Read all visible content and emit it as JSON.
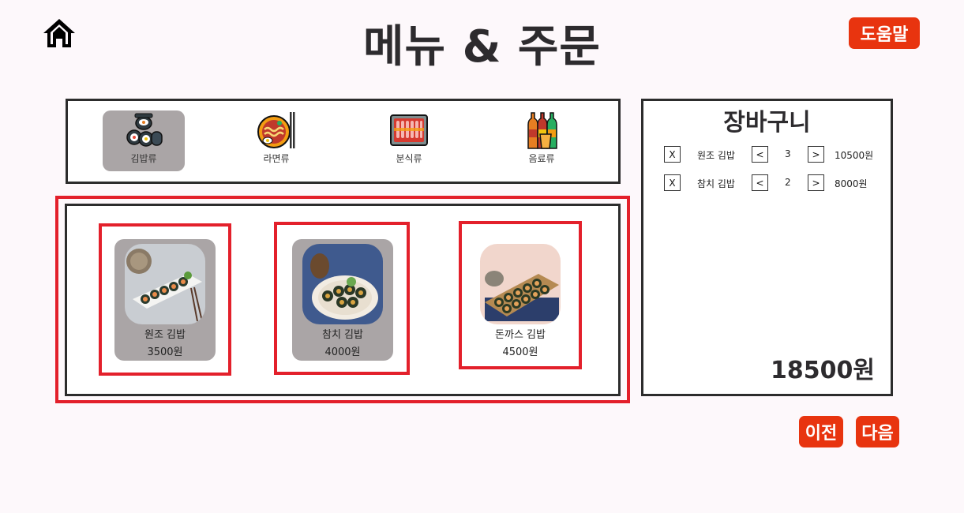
{
  "header": {
    "title": "메뉴 & 주문",
    "help_label": "도움말"
  },
  "categories": [
    {
      "label": "김밥류",
      "icon": "gimbap-icon",
      "active": true
    },
    {
      "label": "라면류",
      "icon": "ramen-icon",
      "active": false
    },
    {
      "label": "분식류",
      "icon": "tteokbokki-icon",
      "active": false
    },
    {
      "label": "음료류",
      "icon": "drinks-icon",
      "active": false
    }
  ],
  "menu_items": [
    {
      "name": "원조 김밥",
      "price": "3500원"
    },
    {
      "name": "참치 김밥",
      "price": "4000원"
    },
    {
      "name": "돈까스 김밥",
      "price": "4500원"
    }
  ],
  "cart": {
    "title": "장바구니",
    "remove_label": "X",
    "dec_label": "<",
    "inc_label": ">",
    "items": [
      {
        "name": "원조 김밥",
        "qty": "3",
        "subtotal": "10500원"
      },
      {
        "name": "참치 김밥",
        "qty": "2",
        "subtotal": "8000원"
      }
    ],
    "total": "18500원"
  },
  "footer": {
    "prev_label": "이전",
    "next_label": "다음"
  },
  "colors": {
    "accent": "#e8340f",
    "highlight": "#e3202b",
    "active_card": "#aaa5a6"
  }
}
